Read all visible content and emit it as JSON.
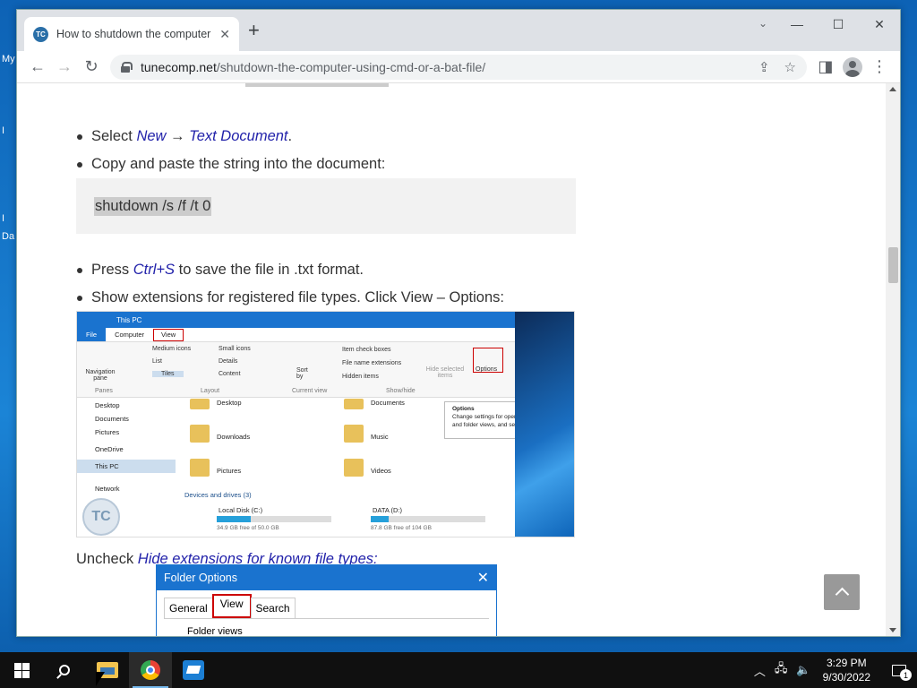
{
  "desktop": {
    "labels": [
      "My",
      "I",
      "I",
      "Da"
    ]
  },
  "browser": {
    "tab_title": "How to shutdown the computer",
    "favicon_text": "TC",
    "url_host": "tunecomp.net",
    "url_path": "/shutdown-the-computer-using-cmd-or-a-bat-file/"
  },
  "article": {
    "step1_prefix": "Select ",
    "step1_new": "New",
    "step1_arrow": " → ",
    "step1_textdoc": "Text Document",
    "step1_suffix": ".",
    "step2": "Copy and paste the string into the document:",
    "code": "shutdown /s /f /t 0",
    "step3_prefix": "Press ",
    "step3_key": "Ctrl+S",
    "step3_suffix": " to save the file in .txt format.",
    "step4": "Show extensions for registered file types. Click View – Options:",
    "uncheck_prefix": "Uncheck ",
    "uncheck_link": "Hide extensions for known file types:"
  },
  "explorer_shot": {
    "title": "This PC",
    "tabs": [
      "File",
      "Computer",
      "View"
    ],
    "ribbon": {
      "nav_pane": "Navigation pane",
      "panes": "Panes",
      "layout_items": [
        "Medium icons",
        "List",
        "Tiles",
        "Small icons",
        "Details",
        "Content"
      ],
      "layout": "Layout",
      "sort_by": "Sort by",
      "current_view": "Current view",
      "checkboxes": [
        "Item check boxes",
        "File name extensions",
        "Hidden items"
      ],
      "hide_selected": "Hide selected items",
      "show_hide": "Show/hide",
      "options": "Options"
    },
    "nav_items": [
      "Desktop",
      "Documents",
      "Pictures",
      "OneDrive",
      "This PC",
      "Network"
    ],
    "folders": [
      "Desktop",
      "Documents",
      "Downloads",
      "Music",
      "Pictures",
      "Videos"
    ],
    "devices_header": "Devices and drives (3)",
    "drives": [
      {
        "name": "Local Disk (C:)",
        "free": "34.9 GB free of 50.0 GB",
        "used_fraction": 0.3
      },
      {
        "name": "DATA (D:)",
        "free": "87.8 GB free of 104 GB",
        "used_fraction": 0.16
      }
    ],
    "tooltip_title": "Options",
    "tooltip_text": "Change settings for opening items, file and folder views, and search.",
    "logo": "TC"
  },
  "folder_options": {
    "title": "Folder Options",
    "tabs": [
      "General",
      "View",
      "Search"
    ],
    "group": "Folder views"
  },
  "taskbar": {
    "time": "3:29 PM",
    "date": "9/30/2022",
    "notification_count": "1"
  }
}
